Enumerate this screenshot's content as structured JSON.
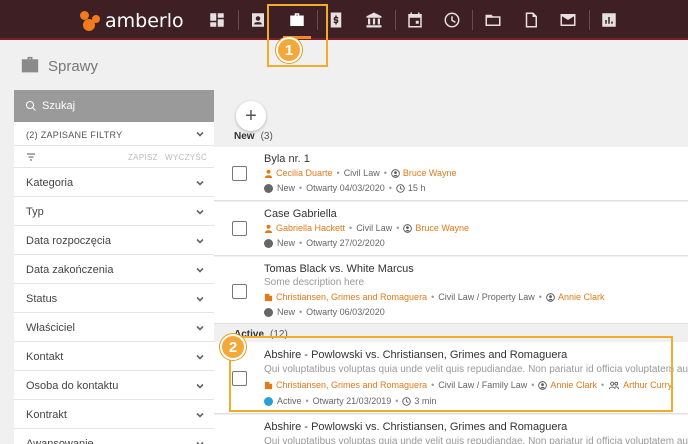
{
  "app": {
    "logo_text": "amberlo"
  },
  "nav": {
    "icons": [
      "dashboard-icon",
      "contacts-icon",
      "matters-briefcase-icon",
      "billing-icon",
      "bank-icon",
      "calendar-icon",
      "time-tracking-icon",
      "folder-icon",
      "documents-icon",
      "mail-icon",
      "reports-icon"
    ],
    "active": "matters-briefcase-icon"
  },
  "badges": {
    "one": "1",
    "two": "2"
  },
  "page": {
    "title": "Sprawy"
  },
  "sidebar": {
    "search_placeholder": "Szukaj",
    "saved_filters": "(2)  ZAPISANE FILTRY",
    "save_label": "ZAPISZ",
    "clear_label": "WYCZYŚĆ",
    "filters": [
      "Kategoria",
      "Typ",
      "Data rozpoczęcia",
      "Data zakończenia",
      "Status",
      "Właściciel",
      "Kontakt",
      "Osoba do kontaktu",
      "Kontrakt",
      "Awansowanie"
    ]
  },
  "groups": {
    "new": {
      "label": "New",
      "count": "(3)"
    },
    "active": {
      "label": "Active",
      "count": "(12)"
    }
  },
  "cards": [
    {
      "title": "Byla nr. 1",
      "desc": "",
      "contact": "Cecilia Duarte",
      "category": "Civil Law",
      "owner": "Bruce Wayne",
      "status": "New",
      "opened": "Otwarty 04/03/2020",
      "time": "15 h",
      "team": ""
    },
    {
      "title": "Case Gabriella",
      "desc": "",
      "contact": "Gabriella Hackett",
      "category": "Civil Law",
      "owner": "Bruce Wayne",
      "status": "New",
      "opened": "Otwarty 27/02/2020",
      "time": "",
      "team": ""
    },
    {
      "title": "Tomas Black vs. White Marcus",
      "desc": "Some description here",
      "contact": "Christiansen, Grimes and Romaguera",
      "category": "Civil Law / Property Law",
      "owner": "Annie Clark",
      "status": "New",
      "opened": "Otwarty 06/03/2020",
      "time": "",
      "team": ""
    },
    {
      "title": "Abshire - Powlowski vs. Christiansen, Grimes and Romaguera",
      "desc": "Qui voluptatibus voluptas quia unde velit quis repudiandae. Non pariatur id officia voluptatem aut a",
      "contact": "Christiansen, Grimes and Romaguera",
      "category": "Civil Law / Family Law",
      "owner": "Annie Clark",
      "status": "Active",
      "opened": "Otwarty 21/03/2019",
      "time": "3 min",
      "team": "Arthur Curry,"
    },
    {
      "title": "Abshire - Powlowski vs. Christiansen, Grimes and Romaguera",
      "desc": "Qui voluptatibus voluptas quia unde velit quis repudiandae. Non pariatur id officia voluptatem aut a",
      "contact": "",
      "category": "",
      "owner": "",
      "status": "",
      "opened": "",
      "time": "",
      "team": ""
    }
  ],
  "colors": {
    "topbar": "#3d1f24",
    "accent": "#f07b1c",
    "highlight": "#f0ac2a",
    "status_new": "#666666",
    "status_active": "#2a9fd6"
  }
}
